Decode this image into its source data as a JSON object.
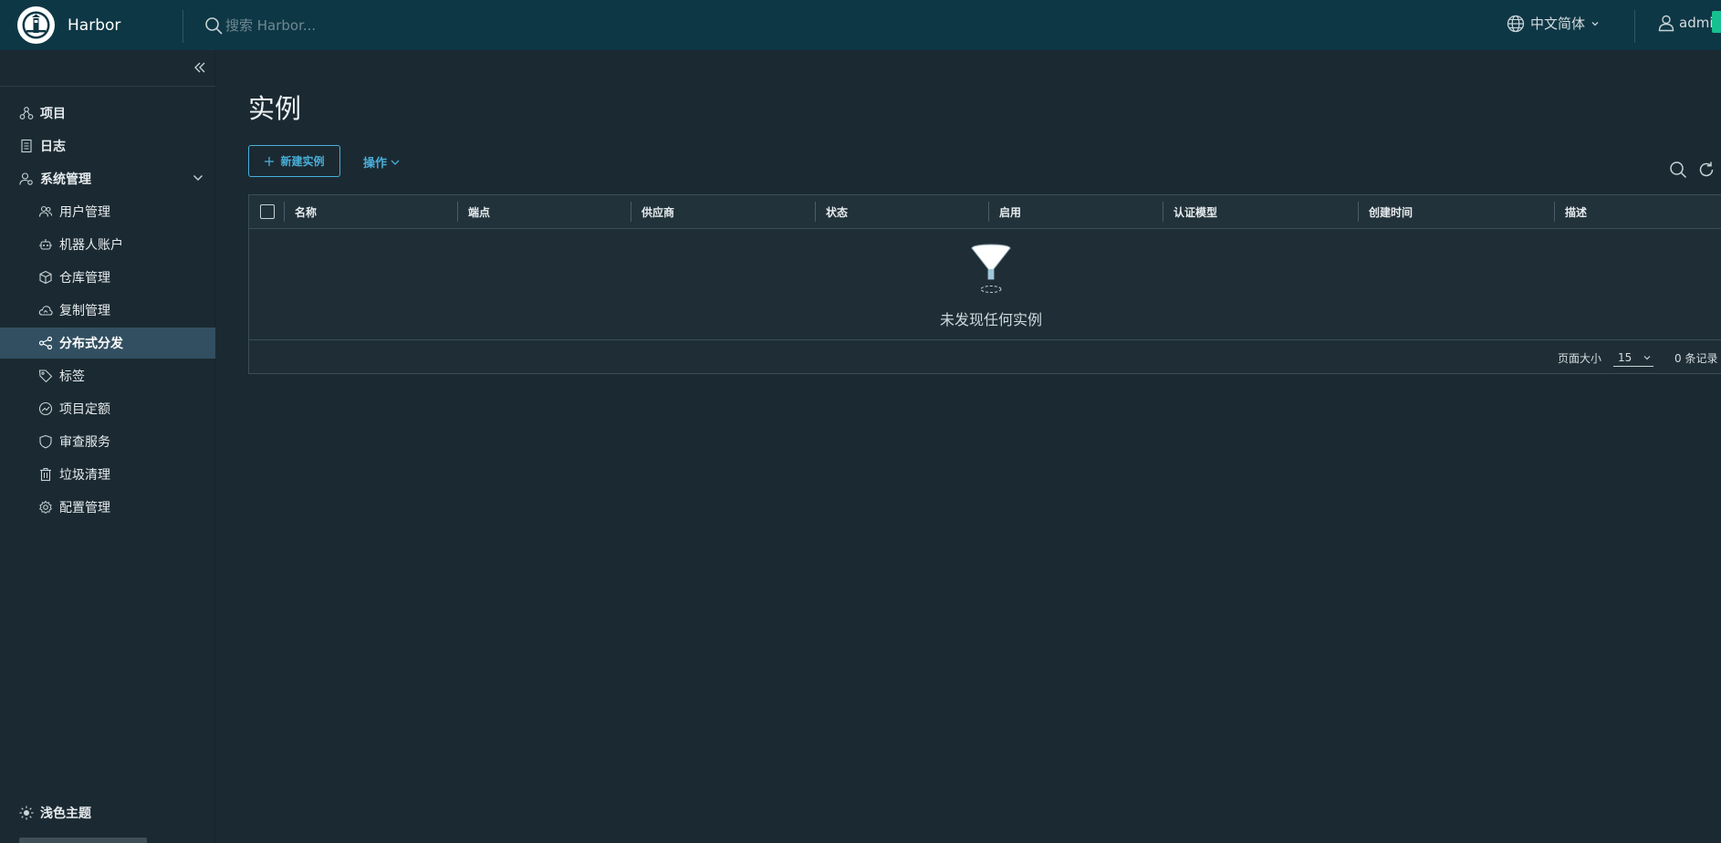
{
  "header": {
    "brand": "Harbor",
    "search_placeholder": "搜索 Harbor...",
    "language": "中文简体",
    "user": "admin"
  },
  "sidebar": {
    "items": [
      {
        "label": "项目",
        "icon": "projects-icon",
        "level": "top"
      },
      {
        "label": "日志",
        "icon": "logs-icon",
        "level": "top"
      },
      {
        "label": "系统管理",
        "icon": "admin-icon",
        "level": "top",
        "expanded": true
      },
      {
        "label": "用户管理",
        "icon": "users-icon",
        "level": "sub"
      },
      {
        "label": "机器人账户",
        "icon": "robot-icon",
        "level": "sub"
      },
      {
        "label": "仓库管理",
        "icon": "registry-icon",
        "level": "sub"
      },
      {
        "label": "复制管理",
        "icon": "replication-icon",
        "level": "sub"
      },
      {
        "label": "分布式分发",
        "icon": "share-icon",
        "level": "sub",
        "active": true
      },
      {
        "label": "标签",
        "icon": "tag-icon",
        "level": "sub"
      },
      {
        "label": "项目定额",
        "icon": "quota-icon",
        "level": "sub"
      },
      {
        "label": "审查服务",
        "icon": "shield-icon",
        "level": "sub"
      },
      {
        "label": "垃圾清理",
        "icon": "trash-icon",
        "level": "sub"
      },
      {
        "label": "配置管理",
        "icon": "gear-icon",
        "level": "sub"
      }
    ],
    "theme_toggle": "浅色主题"
  },
  "main": {
    "title": "实例",
    "new_button": "新建实例",
    "actions_button": "操作",
    "columns": [
      "名称",
      "端点",
      "供应商",
      "状态",
      "启用",
      "认证模型",
      "创建时间",
      "描述"
    ],
    "empty_message": "未发现任何实例",
    "pagination": {
      "page_size_label": "页面大小",
      "page_size": "15",
      "total": "0 条记录"
    }
  },
  "colors": {
    "header_bg": "#0e3745",
    "page_bg": "#1b2a32",
    "accent": "#4aaed9",
    "active_nav": "#324f61"
  }
}
